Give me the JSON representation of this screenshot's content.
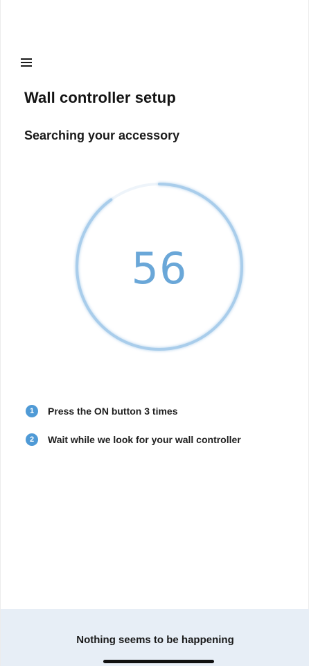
{
  "header": {
    "menu_icon": "hamburger-menu-icon"
  },
  "page": {
    "title": "Wall controller setup",
    "subtitle": "Searching your accessory"
  },
  "timer": {
    "value": "56",
    "progress_fraction": 0.9,
    "color": "#6aa7d8"
  },
  "steps": [
    {
      "number": "1",
      "text": "Press the ON button 3 times"
    },
    {
      "number": "2",
      "text": "Wait while we look for your wall controller"
    }
  ],
  "footer": {
    "help_label": "Nothing seems to be happening",
    "background": "#e7eef6"
  },
  "colors": {
    "accent": "#4f9ad6",
    "ring": "#a9cdeb"
  }
}
